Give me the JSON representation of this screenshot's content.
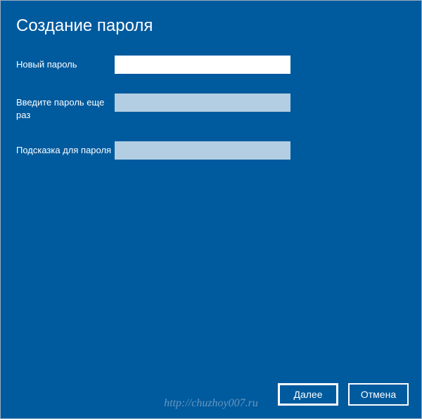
{
  "header": {
    "title": "Создание пароля"
  },
  "form": {
    "fields": [
      {
        "label": "Новый пароль",
        "value": "",
        "type": "password",
        "variant": "bright"
      },
      {
        "label": "Введите пароль еще раз",
        "value": "",
        "type": "password",
        "variant": "dim"
      },
      {
        "label": "Подсказка для пароля",
        "value": "",
        "type": "text",
        "variant": "dim"
      }
    ]
  },
  "buttons": {
    "next": "Далее",
    "cancel": "Отмена"
  },
  "watermark": "http://chuzhoy007.ru"
}
